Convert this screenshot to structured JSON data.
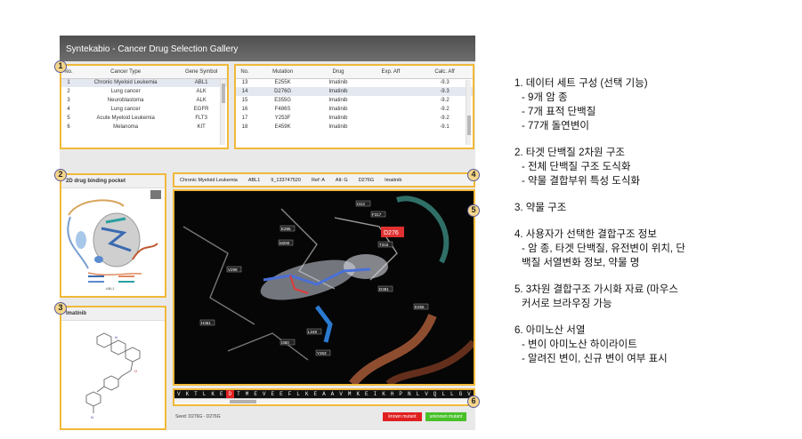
{
  "app": {
    "title": "Syntekabio - Cancer Drug Selection Gallery"
  },
  "badges": [
    "1",
    "2",
    "3",
    "4",
    "5",
    "6"
  ],
  "cancer_table": {
    "headers": [
      "No.",
      "Cancer Type",
      "Gene Symbol"
    ],
    "rows": [
      [
        "1",
        "Chronic Myeloid Leukemia",
        "ABL1"
      ],
      [
        "2",
        "Lung cancer",
        "ALK"
      ],
      [
        "3",
        "Neuroblastoma",
        "ALK"
      ],
      [
        "4",
        "Lung cancer",
        "EGFR"
      ],
      [
        "5",
        "Acute Myeloid Leukemia",
        "FLT3"
      ],
      [
        "6",
        "Melanoma",
        "KIT"
      ]
    ],
    "selected_index": 0
  },
  "mutation_table": {
    "headers": [
      "No.",
      "Mutation",
      "Drug",
      "Exp. Aff",
      "Calc. Aff"
    ],
    "rows": [
      [
        "13",
        "E255K",
        "Imatinib",
        "",
        "-9.3"
      ],
      [
        "14",
        "D276G",
        "Imatinib",
        "",
        "-9.3"
      ],
      [
        "15",
        "E355G",
        "Imatinib",
        "",
        "-9.2"
      ],
      [
        "16",
        "F486S",
        "Imatinib",
        "",
        "-9.2"
      ],
      [
        "17",
        "Y253F",
        "Imatinib",
        "",
        "-9.2"
      ],
      [
        "18",
        "E459K",
        "Imatinib",
        "",
        "-9.1"
      ]
    ],
    "selected_index": 1
  },
  "pocket_panel": {
    "title": "2D drug binding pocket"
  },
  "drug_panel": {
    "title": "Imatinib"
  },
  "info_bar": {
    "cancer": "Chronic Myeloid Leukemia",
    "gene": "ABL1",
    "position": "9_133747520",
    "ref": "Ref: A",
    "alt": "Alt: G",
    "mutation": "D276G",
    "drug": "Imatinib"
  },
  "viewer": {
    "mutation_label": "D276",
    "residue_labels": [
      "I313",
      "F317",
      "T315",
      "E286",
      "M290",
      "V299",
      "D381",
      "L248",
      "Y253",
      "I360",
      "H361",
      "E255"
    ]
  },
  "sequence": {
    "residues": [
      "V",
      "K",
      "T",
      "L",
      "K",
      "E",
      "D",
      "T",
      "M",
      "E",
      "V",
      "E",
      "E",
      "F",
      "L",
      "K",
      "E",
      "A",
      "A",
      "V",
      "M",
      "K",
      "E",
      "I",
      "K",
      "H",
      "P",
      "N",
      "L",
      "V",
      "Q",
      "L",
      "L",
      "G",
      "V"
    ],
    "mutant_index": 6
  },
  "footer": {
    "status": "Seed: D276G - D276G",
    "known_mutant": "known mutant",
    "unknown_mutant": "unknown mutant"
  },
  "colors": {
    "highlight_border": "#f0b93a",
    "known_mutant": "#e02020",
    "unknown_mutant": "#48c028",
    "mutation": "#e02020"
  },
  "notes": [
    {
      "title": "1. 데이터 세트 구성 (선택 기능)",
      "items": [
        "- 9개 암 종",
        "- 7개 표적 단백질",
        "- 77개 돌연변이"
      ]
    },
    {
      "title": "2. 타겟 단백질 2차원 구조",
      "items": [
        "- 전체 단백질 구조 도식화",
        "- 약물 결합부위 특성 도식화"
      ]
    },
    {
      "title": "3. 약물 구조",
      "items": []
    },
    {
      "title": "4. 사용자가 선택한 결합구조 정보",
      "items": [
        "- 암 종, 타겟 단백질, 유전변이 위치, 단",
        "백질 서열변화 정보, 약물 명"
      ]
    },
    {
      "title": "5. 3차원 결합구조 가시화 자료 (마우스",
      "items": [
        "커서로 브라우징 가능"
      ]
    },
    {
      "title": "6. 아미노산 서열",
      "items": [
        "- 변이 아미노산 하이라이트",
        "- 알려진 변이, 신규 변이 여부 표시"
      ]
    }
  ]
}
